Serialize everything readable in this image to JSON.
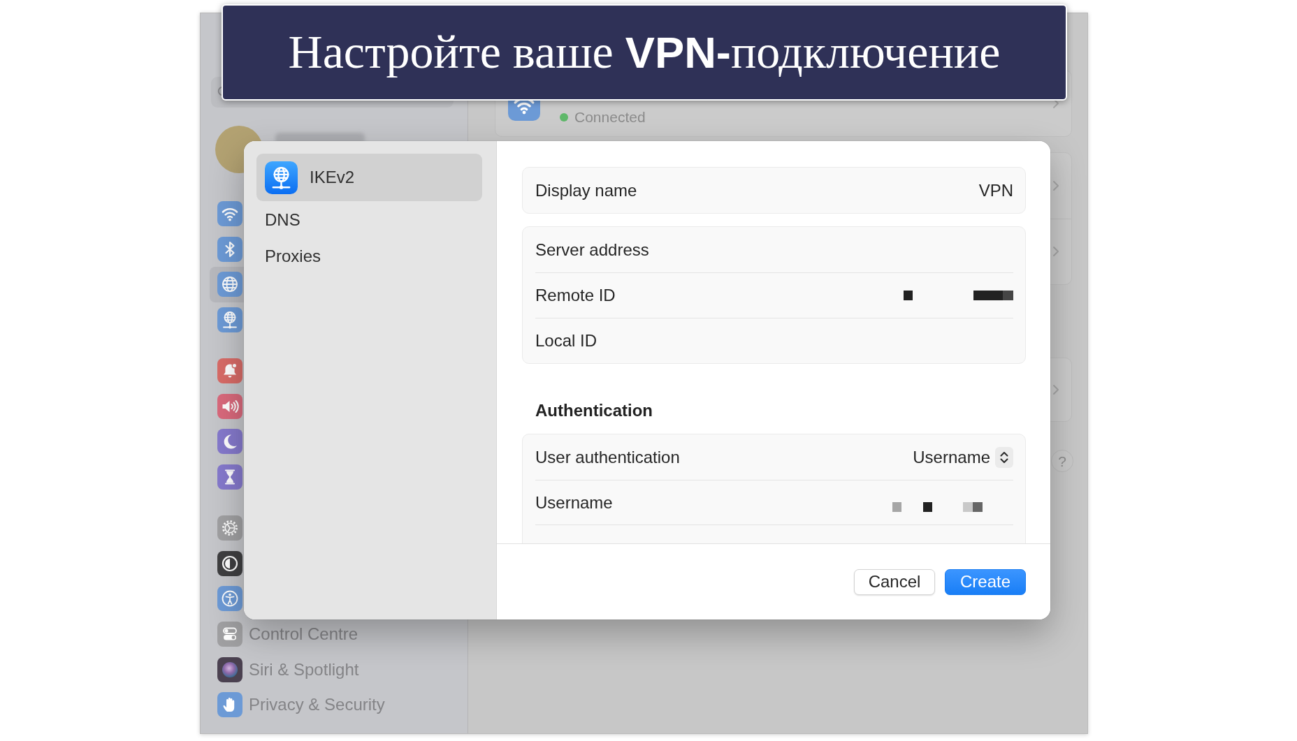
{
  "banner": {
    "title": "Настройте ваше **VPN-**подключение"
  },
  "sidebar": {
    "groups": [
      [
        {
          "kind": "wifi",
          "selected": false
        },
        {
          "kind": "bluetooth",
          "selected": false
        },
        {
          "kind": "network",
          "selected": true
        },
        {
          "kind": "vpn",
          "selected": false
        }
      ],
      [
        {
          "kind": "notifications",
          "selected": false
        },
        {
          "kind": "sound",
          "selected": false
        },
        {
          "kind": "focus",
          "selected": false
        },
        {
          "kind": "screen_time",
          "selected": false
        }
      ],
      [
        {
          "kind": "general",
          "selected": false
        },
        {
          "kind": "appearance",
          "selected": false
        },
        {
          "kind": "accessibility",
          "selected": false
        },
        {
          "kind": "control_centre",
          "label": "Control Centre",
          "selected": false
        },
        {
          "kind": "siri",
          "label": "Siri & Spotlight",
          "selected": false
        },
        {
          "kind": "privacy",
          "label": "Privacy & Security",
          "selected": false
        }
      ]
    ]
  },
  "wifi": {
    "status": "Connected",
    "connected": true
  },
  "help": "?",
  "dialog": {
    "sidebar": [
      {
        "kind": "vpn",
        "label": "IKEv2",
        "selected": true
      },
      {
        "kind": "plain",
        "label": "DNS",
        "selected": false
      },
      {
        "kind": "plain",
        "label": "Proxies",
        "selected": false
      }
    ],
    "groups": [
      {
        "rows": [
          {
            "kind": "text",
            "label": "Display name",
            "value": "VPN"
          }
        ]
      },
      {
        "rows": [
          {
            "kind": "text",
            "label": "Server address"
          },
          {
            "kind": "redacted",
            "label": "Remote ID"
          },
          {
            "kind": "text",
            "label": "Local ID"
          }
        ]
      },
      {
        "title": "Authentication",
        "rows": [
          {
            "kind": "popup",
            "label": "User authentication",
            "value": "Username"
          },
          {
            "kind": "redacted",
            "label": "Username"
          }
        ]
      }
    ],
    "buttons": [
      {
        "kind": "secondary",
        "label": "Cancel"
      },
      {
        "kind": "primary",
        "label": "Create"
      }
    ]
  }
}
